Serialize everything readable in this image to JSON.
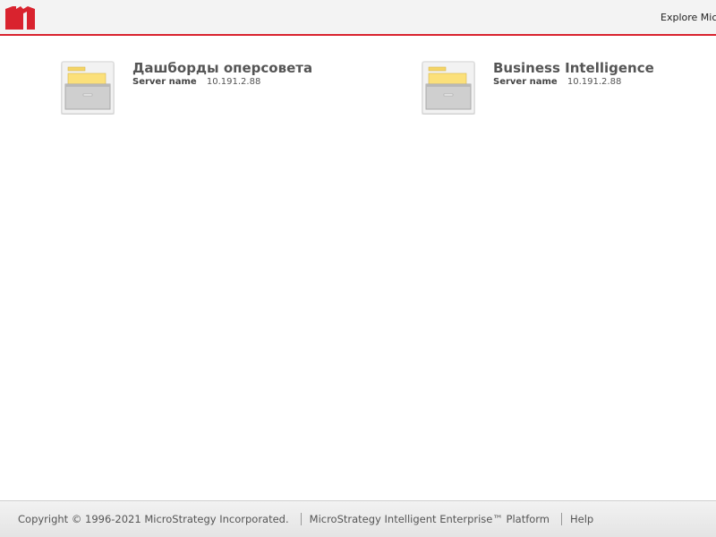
{
  "header": {
    "logo_icon": "microstrategy-logo",
    "explore_label": "Explore Micro"
  },
  "projects": [
    {
      "title": "Дашборды оперсовета",
      "server_label": "Server name",
      "server_value": "10.191.2.88",
      "icon": "folder-drawer-icon"
    },
    {
      "title": "Business Intelligence",
      "server_label": "Server name",
      "server_value": "10.191.2.88",
      "icon": "folder-drawer-icon"
    }
  ],
  "footer": {
    "copyright": "Copyright © 1996-2021 MicroStrategy Incorporated.",
    "platform": "MicroStrategy Intelligent Enterprise™ Platform",
    "help": "Help"
  },
  "colors": {
    "brand_red": "#d9232e",
    "title_gray": "#555555"
  }
}
